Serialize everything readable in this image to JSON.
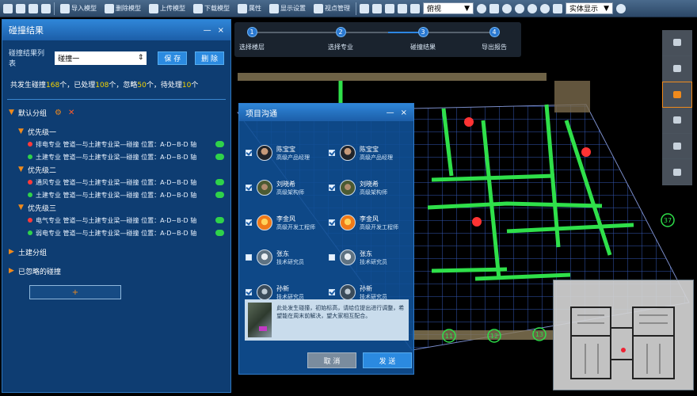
{
  "toolbar": {
    "import_model": "导入模型",
    "delete_model": "删除模型",
    "upload_model": "上传模型",
    "download_model": "下载模型",
    "attributes": "属性",
    "browse_settings": "显示设置",
    "view_manage": "视点管理",
    "view_select": "俯视",
    "display_mode": "实体显示"
  },
  "panel": {
    "title": "碰撞结果",
    "min": "—",
    "close": "×",
    "list_label": "碰撞结果列表",
    "list_value": "碰撞一",
    "save_btn": "保 存",
    "delete_btn": "删 除",
    "summary": {
      "p1": "共发生碰撞",
      "total": "168",
      "p2": "个，已处理",
      "done": "108",
      "p3": "个，忽略",
      "ignored": "50",
      "p4": "个，待处理",
      "pending": "10",
      "p5": "个"
    },
    "groups": [
      {
        "label": "默认分组"
      },
      {
        "label": "土建分组"
      },
      {
        "label": "已忽略的碰撞"
      }
    ],
    "priorities": [
      {
        "label": "优先级一",
        "items": [
          {
            "text": "排电专业  管道—与土建专业梁—碰撞    位置：A-D~B-D 轴",
            "color": "#ff3a3a"
          },
          {
            "text": "土建专业  管道—与土建专业梁—碰撞    位置：A-D~B-D 轴",
            "color": "#2fd24a"
          }
        ]
      },
      {
        "label": "优先级二",
        "items": [
          {
            "text": "通风专业  管道—与土建专业梁—碰撞    位置：A-D~B-D 轴",
            "color": "#ff3a3a"
          },
          {
            "text": "土建专业  管道—与土建专业梁—碰撞    位置：A-D~B-D 轴",
            "color": "#2fd24a"
          }
        ]
      },
      {
        "label": "优先级三",
        "items": [
          {
            "text": "电气专业  管道—与土建专业梁—碰撞    位置：A-D~B-D 轴",
            "color": "#ff3a3a"
          },
          {
            "text": "弱电专业  管道—与土建专业梁—碰撞    位置：A-D~B-D 轴",
            "color": "#2fd24a"
          }
        ]
      }
    ],
    "add_btn": "+"
  },
  "steps": [
    {
      "num": "1",
      "label": "选择楼层"
    },
    {
      "num": "2",
      "label": "选择专业"
    },
    {
      "num": "3",
      "label": "碰撞结果"
    },
    {
      "num": "4",
      "label": "导出报告"
    }
  ],
  "dialog": {
    "title": "项目沟通",
    "min": "—",
    "close": "×",
    "members": [
      {
        "name": "陈宝宝",
        "role": "高级产品经理"
      },
      {
        "name": "陈宝宝",
        "role": "高级产品经理"
      },
      {
        "name": "刘晓希",
        "role": "高级架构师"
      },
      {
        "name": "刘晓希",
        "role": "高级架构师"
      },
      {
        "name": "李金风",
        "role": "高级开发工程师"
      },
      {
        "name": "李金风",
        "role": "高级开发工程师"
      },
      {
        "name": "张东",
        "role": "技术研究员"
      },
      {
        "name": "张东",
        "role": "技术研究员"
      },
      {
        "name": "孙新",
        "role": "技术研究员"
      },
      {
        "name": "孙新",
        "role": "技术研究员"
      }
    ],
    "message": "此处发生碰撞，初始标高，请给位提出进行调整，希望能在周末前解决，望大家相互配合。",
    "cancel_btn": "取 消",
    "send_btn": "发 送"
  },
  "scene": {
    "axis_labels": [
      "11",
      "12",
      "13",
      "37"
    ]
  },
  "colors": {
    "pipe": "#2fe04a",
    "grid": "#3a62c8",
    "marker": "#ff3333",
    "accent": "#f08a1c"
  }
}
